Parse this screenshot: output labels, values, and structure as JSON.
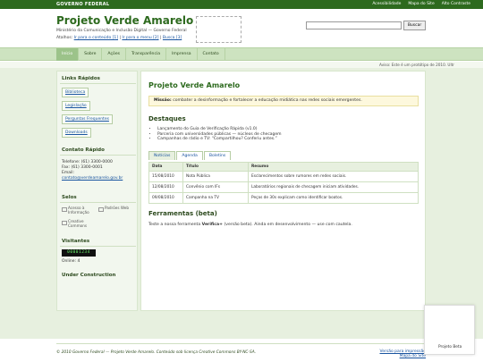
{
  "gov_bar": {
    "brand": "GOVERNO FEDERAL",
    "links": [
      "Acessibilidade",
      "Mapa do Site",
      "Alto Contraste"
    ]
  },
  "header": {
    "title": "Projeto Verde Amarelo",
    "subtitle": "Ministério da Comunicação e Inclusão Digital — Governo Federal",
    "atalhos_label": "Atalhos:",
    "atalhos": [
      "Ir para o conteúdo [1]",
      "Ir para o menu [2]",
      "Busca [3]"
    ],
    "search_placeholder": "",
    "search_button": "Buscar"
  },
  "nav": {
    "items": [
      "Início",
      "Sobre",
      "Ações",
      "Transparência",
      "Imprensa",
      "Contato"
    ],
    "active_index": 0
  },
  "notice": "Aviso: Este é um protótipo de 2010. Ultr",
  "sidebar": {
    "quick_title": "Links Rápidos",
    "quick_links": [
      "Biblioteca",
      "Legislação",
      "Perguntas Frequentes",
      "Downloads"
    ],
    "contact_title": "Contato Rápido",
    "phone": "Telefone: (61) 3300-0000",
    "fax": "Fax: (61) 3300-0001",
    "email_label": "Email:",
    "email": "contato@verdeamarelo.gov.br",
    "seals_title": "Selos",
    "seals": [
      "Acesso à Informação",
      "Padrões Web",
      "Creative Commons"
    ],
    "visitors_title": "Visitantes",
    "counter": "00001234",
    "online": "Online: 4",
    "construction_title": "Under Construction"
  },
  "main": {
    "title": "Projeto Verde Amarelo",
    "mission_label": "Missão:",
    "mission_text": "combater a desinformação e fortalecer a educação midiática nas redes sociais emergentes.",
    "highlights_title": "Destaques",
    "highlights": [
      "Lançamento do Guia de Verificação Rápida (v1.0)",
      "Parceria com universidades públicas — núcleos de checagem",
      "Campanhas de rádio e TV: “Compartilhou? Conferiu antes.”"
    ],
    "tabs": [
      "Notícias",
      "Agenda",
      "Boletins"
    ],
    "table": {
      "headers": [
        "Data",
        "Título",
        "Resumo"
      ],
      "rows": [
        [
          "15/08/2010",
          "Nota Pública",
          "Esclarecimentos sobre rumores em redes sociais."
        ],
        [
          "12/08/2010",
          "Convênio com IFs",
          "Laboratórios regionais de checagem iniciam atividades."
        ],
        [
          "09/08/2010",
          "Campanha na TV",
          "Peças de 30s explicam como identificar boatos."
        ]
      ]
    },
    "beta_title": "Ferramentas (beta)",
    "beta_pre": "Teste a nossa ferramenta ",
    "beta_tool": "Verifica+",
    "beta_post": " (versão beta). Ainda em desenvolvimento — use com cautela."
  },
  "footer": {
    "text": "© 2010 Governo Federal — Projeto Verde Amarelo. Conteúdo sob licença Creative Commons BY-NC-SA.",
    "print_link": "Versão para impressão",
    "sitemap_link": "Mapa do Site"
  },
  "widget": {
    "label": "Projeto Beta"
  }
}
